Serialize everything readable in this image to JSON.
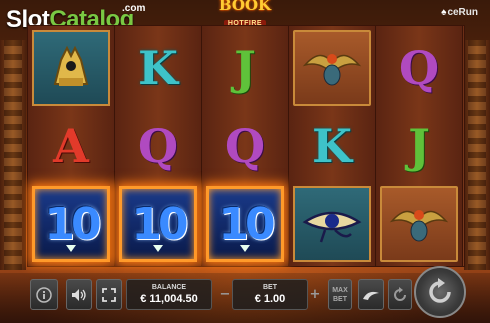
{
  "header": {
    "watermark_part1": "Slot",
    "watermark_part2": "Catalog",
    "watermark_domain": ".com",
    "game_title_line1": "BOOK",
    "game_title_line2": "HOTFIRE",
    "provider": "ceRun"
  },
  "reels": [
    [
      "anubis-symbol",
      "A",
      "10"
    ],
    [
      "K",
      "Q",
      "10"
    ],
    [
      "J",
      "Q",
      "10"
    ],
    [
      "scarab-symbol",
      "K",
      "eye-of-horus-symbol"
    ],
    [
      "Q",
      "J",
      "scarab-symbol"
    ]
  ],
  "controls": {
    "balance_label": "BALANCE",
    "balance_value": "€ 11,004.50",
    "bet_label": "BET",
    "bet_value": "€ 1.00",
    "minus_label": "−",
    "plus_label": "+",
    "maxbet_line1": "MAX",
    "maxbet_line2": "BET"
  },
  "colors": {
    "letter_K": "#3ec3c9",
    "letter_J": "#5fc23a",
    "letter_Q": "#b04ac0",
    "letter_A": "#e23a2a",
    "ten_glow": "#ff7a10",
    "watermark_green": "#7ac943"
  },
  "icons": [
    "info-icon",
    "sound-icon",
    "fullscreen-icon",
    "fast-play-icon",
    "autoplay-icon",
    "spin-icon"
  ]
}
